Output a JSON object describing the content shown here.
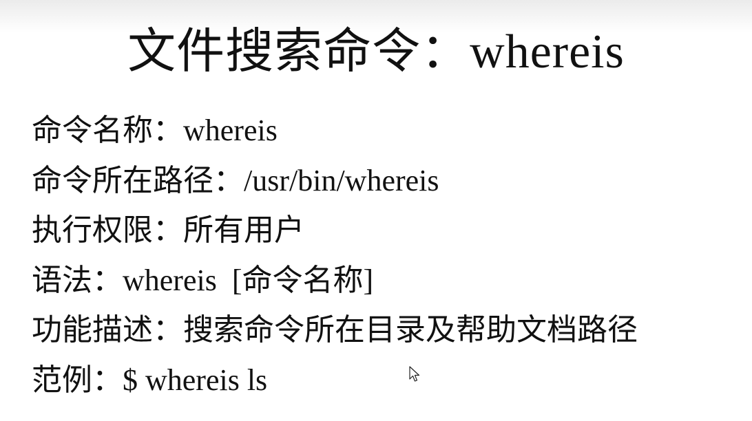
{
  "slide": {
    "title": "文件搜索命令：whereis",
    "lines": [
      {
        "text": "命令名称：whereis"
      },
      {
        "text": "命令所在路径：/usr/bin/whereis"
      },
      {
        "text": "执行权限：所有用户"
      },
      {
        "text": "语法：whereis  [命令名称]"
      },
      {
        "text": "功能描述：搜索命令所在目录及帮助文档路径"
      },
      {
        "text": "范例：$ whereis ls"
      }
    ]
  },
  "cursor": {
    "icon": "mouse-pointer-icon"
  }
}
